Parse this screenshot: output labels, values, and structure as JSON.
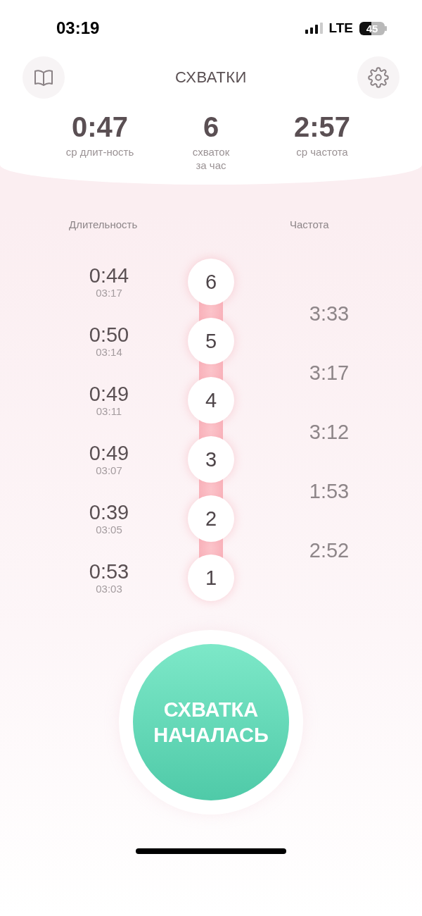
{
  "status_bar": {
    "time": "03:19",
    "network": "LTE",
    "battery": "45"
  },
  "header": {
    "title": "СХВАТКИ"
  },
  "stats": [
    {
      "value": "0:47",
      "label": "ср длит-ность"
    },
    {
      "value": "6",
      "label": "схваток\nза час"
    },
    {
      "value": "2:57",
      "label": "ср частота"
    }
  ],
  "columns": {
    "duration": "Длительность",
    "frequency": "Частота"
  },
  "contractions": [
    {
      "number": "6",
      "duration": "0:44",
      "start": "03:17",
      "frequency": "3:33"
    },
    {
      "number": "5",
      "duration": "0:50",
      "start": "03:14",
      "frequency": "3:17"
    },
    {
      "number": "4",
      "duration": "0:49",
      "start": "03:11",
      "frequency": "3:12"
    },
    {
      "number": "3",
      "duration": "0:49",
      "start": "03:07",
      "frequency": "1:53"
    },
    {
      "number": "2",
      "duration": "0:39",
      "start": "03:05",
      "frequency": "2:52"
    },
    {
      "number": "1",
      "duration": "0:53",
      "start": "03:03"
    }
  ],
  "start_button": {
    "label": "СХВАТКА\nНАЧАЛАСЬ"
  }
}
